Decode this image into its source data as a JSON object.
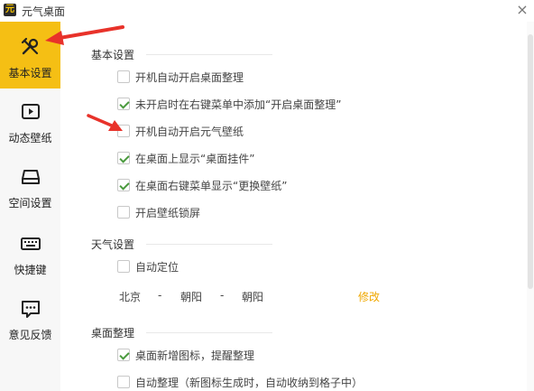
{
  "window": {
    "title": "元气桌面",
    "logo_text": "元",
    "close_glyph": "×"
  },
  "sidebar": {
    "items": [
      {
        "label": "基本设置",
        "icon": "tools-icon",
        "active": true
      },
      {
        "label": "动态壁纸",
        "icon": "play-screen-icon",
        "active": false
      },
      {
        "label": "空间设置",
        "icon": "drive-icon",
        "active": false
      },
      {
        "label": "快捷键",
        "icon": "keyboard-icon",
        "active": false
      },
      {
        "label": "意见反馈",
        "icon": "feedback-icon",
        "active": false
      }
    ]
  },
  "sections": {
    "basic": {
      "title": "基本设置",
      "options": [
        {
          "label": "开机自动开启桌面整理",
          "checked": false
        },
        {
          "label": "未开启时在右键菜单中添加“开启桌面整理”",
          "checked": true
        },
        {
          "label": "开机自动开启元气壁纸",
          "checked": false
        },
        {
          "label": "在桌面上显示“桌面挂件”",
          "checked": true
        },
        {
          "label": "在桌面右键菜单显示“更换壁纸”",
          "checked": true
        },
        {
          "label": "开启壁纸锁屏",
          "checked": false
        }
      ]
    },
    "weather": {
      "title": "天气设置",
      "auto_locate": {
        "label": "自动定位",
        "checked": false
      },
      "location": {
        "province": "北京",
        "sep1": "-",
        "city": "朝阳",
        "sep2": "-",
        "district": "朝阳",
        "edit_label": "修改"
      }
    },
    "desktop": {
      "title": "桌面整理",
      "options": [
        {
          "label": "桌面新增图标，提醒整理",
          "checked": true
        },
        {
          "label": "自动整理（新图标生成时，自动收纳到格子中）",
          "checked": false
        }
      ]
    }
  },
  "colors": {
    "accent": "#f5bf14",
    "check": "#4a9a3e",
    "link": "#f0a800",
    "annotation_arrow": "#e8322a"
  }
}
